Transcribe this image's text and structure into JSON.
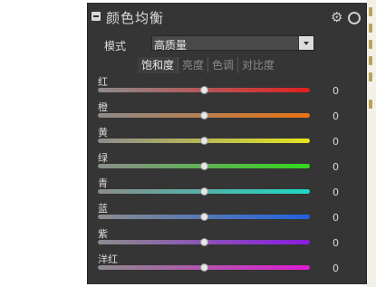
{
  "panel": {
    "title": "颜色均衡",
    "mode_label": "模式",
    "mode_value": "高质量",
    "tabs": [
      {
        "label": "饱和度",
        "active": true
      },
      {
        "label": "亮度",
        "active": false
      },
      {
        "label": "色调",
        "active": false
      },
      {
        "label": "对比度",
        "active": false
      }
    ],
    "sliders": [
      {
        "label": "红",
        "value": "0",
        "color": "#e02020"
      },
      {
        "label": "橙",
        "value": "0",
        "color": "#ea7412"
      },
      {
        "label": "黄",
        "value": "0",
        "color": "#e6e61e"
      },
      {
        "label": "绿",
        "value": "0",
        "color": "#32d81c"
      },
      {
        "label": "青",
        "value": "0",
        "color": "#1cd8c4"
      },
      {
        "label": "蓝",
        "value": "0",
        "color": "#1f62e0"
      },
      {
        "label": "紫",
        "value": "0",
        "color": "#8a1ae0"
      },
      {
        "label": "洋红",
        "value": "0",
        "color": "#e01ad4"
      }
    ],
    "icons": {
      "collapse": "collapse-minus-icon",
      "settings": "gear-icon",
      "toggle": "circle-toggle-icon"
    }
  }
}
